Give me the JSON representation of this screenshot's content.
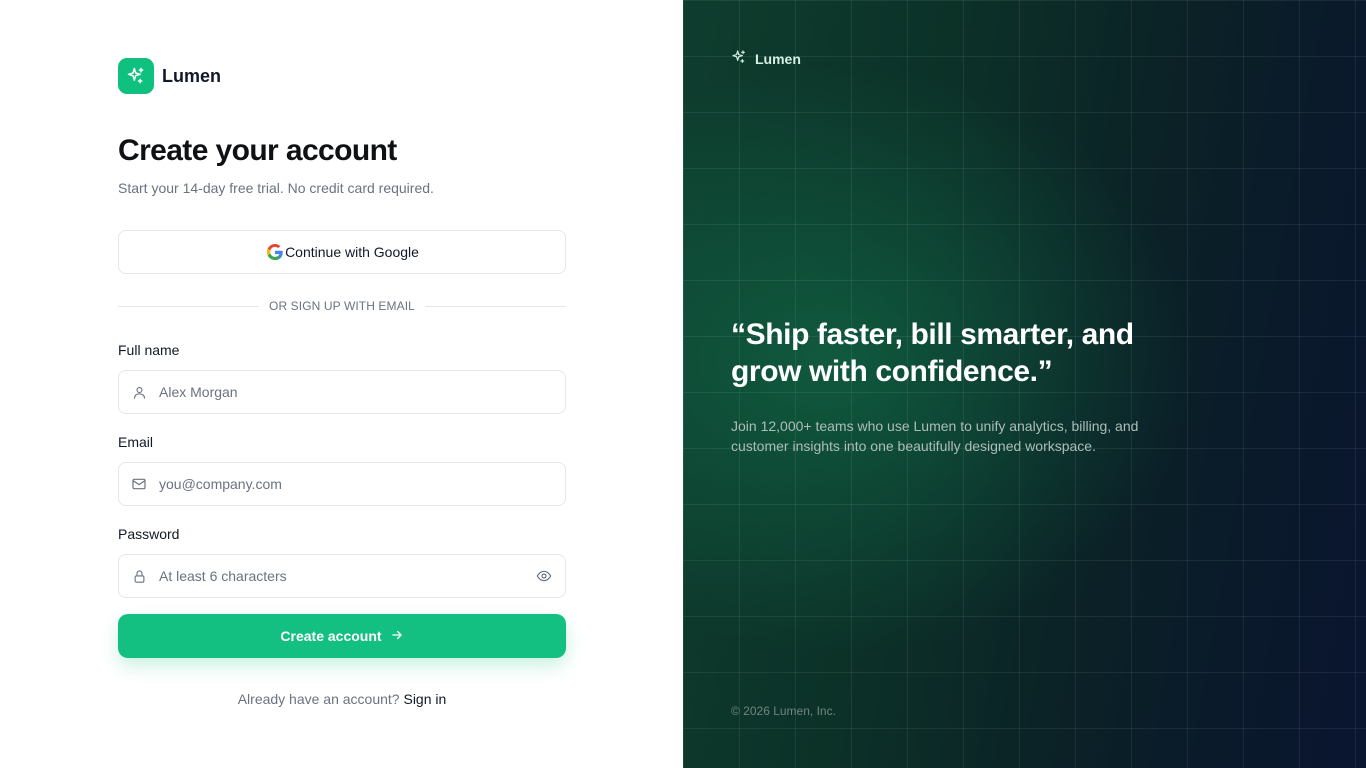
{
  "brand": {
    "name": "Lumen",
    "icon": "sparkle-icon",
    "color": "#10c07f"
  },
  "form": {
    "title": "Create your account",
    "subtitle": "Start your 14-day free trial. No credit card required.",
    "google_button": "Continue with Google",
    "divider": "OR SIGN UP WITH EMAIL",
    "fields": {
      "full_name": {
        "label": "Full name",
        "placeholder": "Alex Morgan",
        "icon": "user-icon"
      },
      "email": {
        "label": "Email",
        "placeholder": "you@company.com",
        "icon": "mail-icon"
      },
      "password": {
        "label": "Password",
        "placeholder": "At least 6 characters",
        "icon": "lock-icon",
        "toggle_icon": "eye-icon"
      }
    },
    "submit": "Create account",
    "signin_prompt": "Already have an account?",
    "signin_link": "Sign in"
  },
  "hero": {
    "brand": "Lumen",
    "quote": "“Ship faster, bill smarter, and grow with confidence.”",
    "body": "Join 12,000+ teams who use Lumen to unify analytics, billing, and customer insights into one beautifully designed workspace.",
    "copyright": "© 2026 Lumen, Inc."
  },
  "colors": {
    "accent": "#14c081",
    "hero_bg_start": "#0e3d2e",
    "hero_bg_end": "#0a1530"
  }
}
